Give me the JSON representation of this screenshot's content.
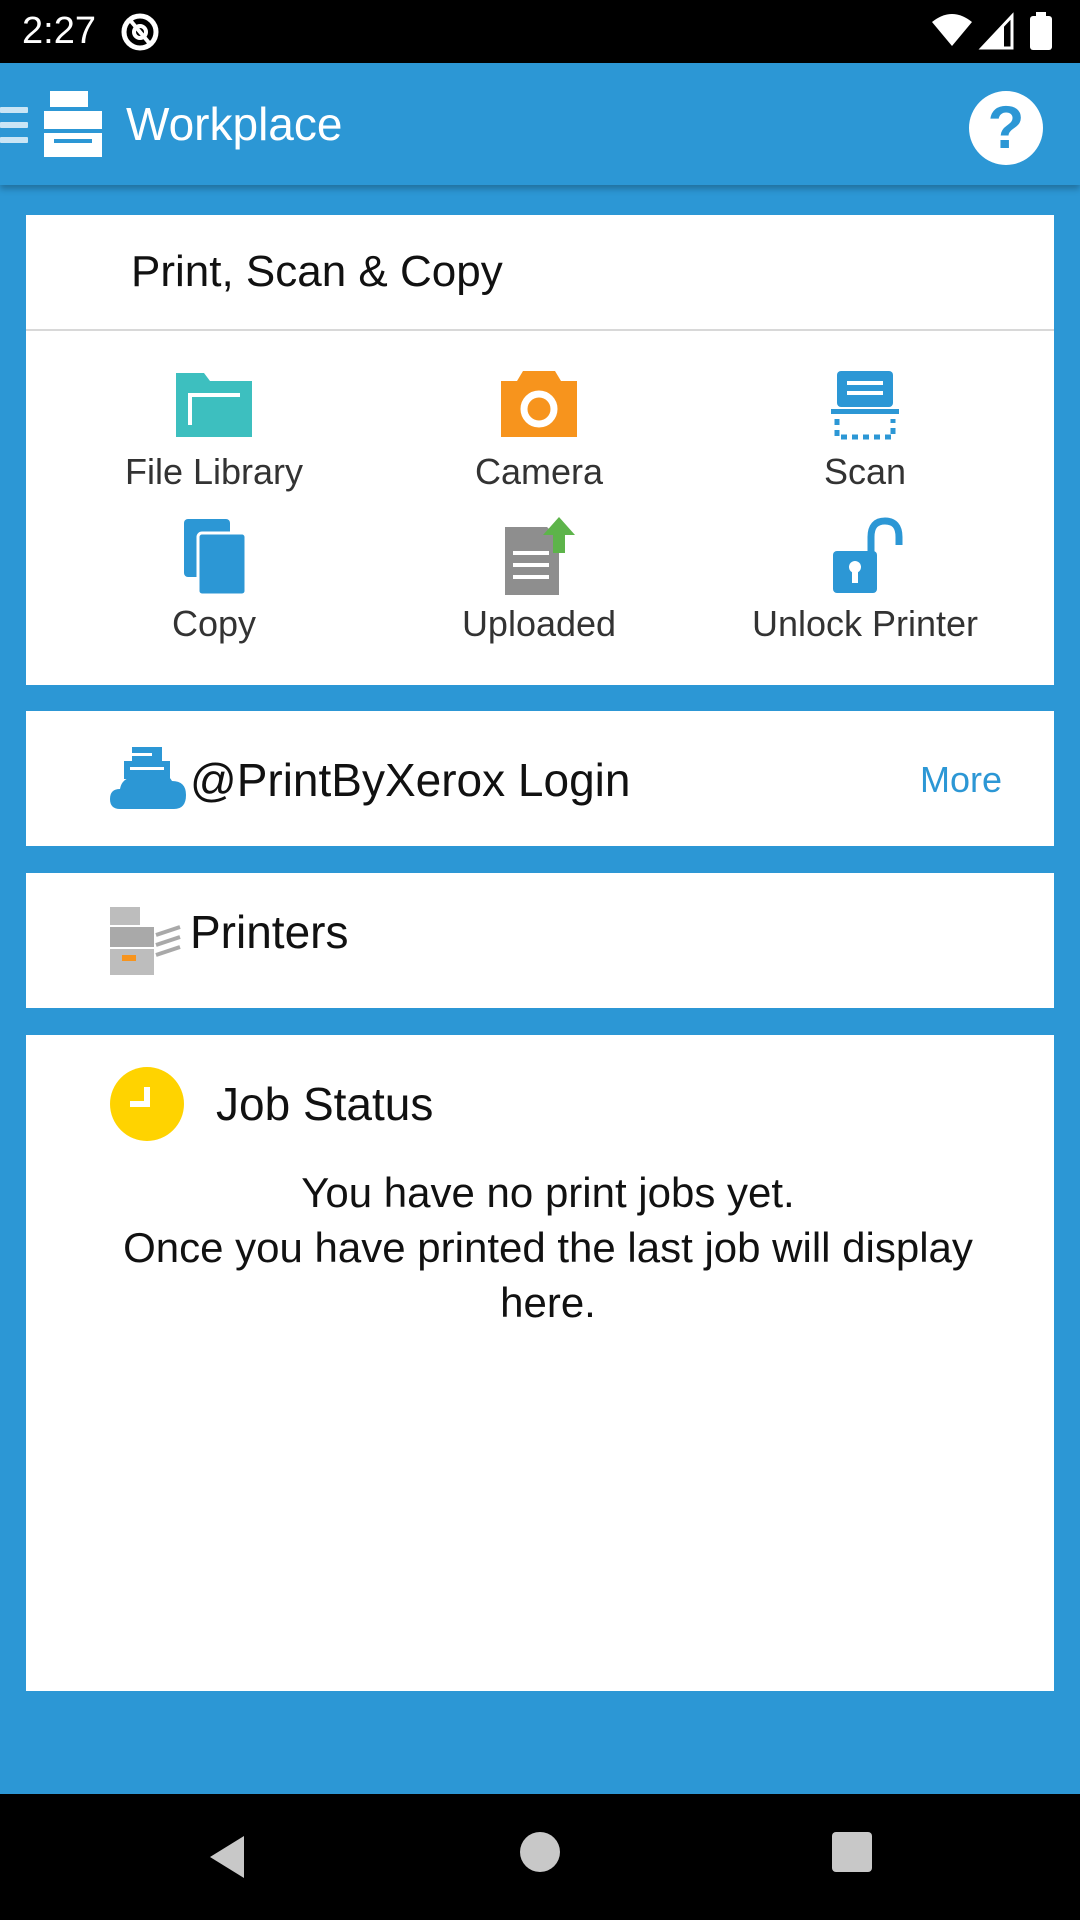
{
  "status_bar": {
    "time": "2:27",
    "icons": [
      "at-sign-icon",
      "wifi-icon",
      "signal-icon",
      "battery-icon"
    ]
  },
  "app_bar": {
    "title": "Workplace",
    "help_label": "?"
  },
  "print_scan_copy": {
    "title": "Print, Scan & Copy",
    "tiles": [
      {
        "label": "File Library",
        "icon": "folder-icon",
        "color": "#3DBFBF"
      },
      {
        "label": "Camera",
        "icon": "camera-icon",
        "color": "#F7941D"
      },
      {
        "label": "Scan",
        "icon": "scanner-icon",
        "color": "#2C97D5"
      },
      {
        "label": "Copy",
        "icon": "copy-icon",
        "color": "#2C97D5"
      },
      {
        "label": "Uploaded",
        "icon": "upload-document-icon",
        "color": "#8E8E8E"
      },
      {
        "label": "Unlock Printer",
        "icon": "unlock-icon",
        "color": "#2C97D5"
      }
    ]
  },
  "login": {
    "label": "@PrintByXerox Login",
    "more": "More"
  },
  "printers": {
    "label": "Printers"
  },
  "job_status": {
    "title": "Job Status",
    "message_line1": "You have no print jobs yet.",
    "message_line2": "Once you have printed the last job will display here."
  },
  "colors": {
    "primary": "#2C97D5",
    "clock_yellow": "#FFD300",
    "upload_green": "#5DB44A"
  }
}
